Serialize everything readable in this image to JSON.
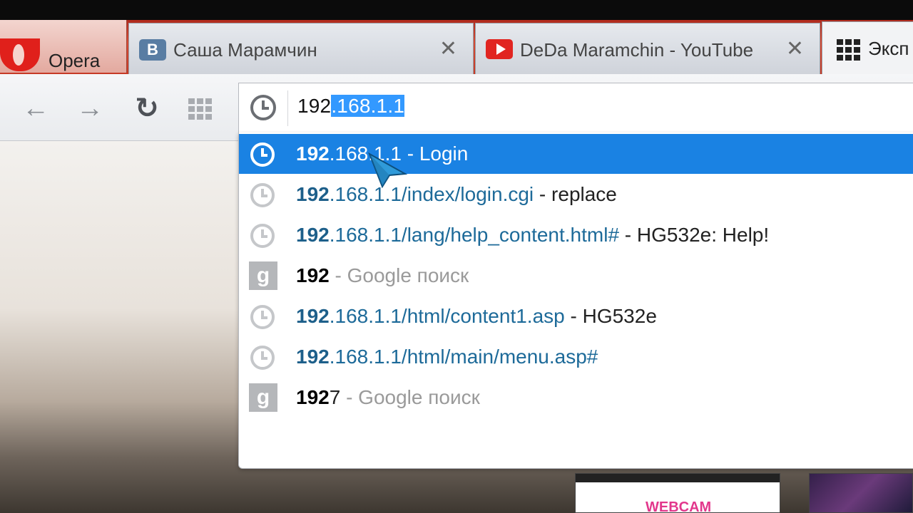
{
  "browser": {
    "menu_label": "Opera"
  },
  "tabs": [
    {
      "title": "Саша Марамчин",
      "favicon": "vk-icon",
      "close": "✕"
    },
    {
      "title": "DeDa Maramchin - YouTube",
      "favicon": "youtube-icon",
      "close": "✕"
    },
    {
      "title": "Эксп",
      "favicon": "speed-dial-icon"
    }
  ],
  "toolbar": {
    "back_icon": "←",
    "forward_icon": "→",
    "reload_icon": "↻"
  },
  "address": {
    "typed": "192",
    "autocompleted": ".168.1.1"
  },
  "suggestions": [
    {
      "icon": "history-clock-icon",
      "match": "192",
      "rest": ".168.1.1",
      "sep": " - ",
      "title": "Login",
      "selected": true
    },
    {
      "icon": "history-clock-icon",
      "match": "192",
      "rest": ".168.1.1/index/login.cgi",
      "sep": " - ",
      "title": "replace"
    },
    {
      "icon": "history-clock-icon",
      "match": "192",
      "rest": ".168.1.1/lang/help_content.html#",
      "sep": " - ",
      "title": "HG532e: Help!"
    },
    {
      "icon": "google-search-icon",
      "query": "192",
      "search": " - Google поиск"
    },
    {
      "icon": "history-clock-icon",
      "match": "192",
      "rest": ".168.1.1/html/content1.asp",
      "sep": " - ",
      "title": "HG532e"
    },
    {
      "icon": "history-clock-icon",
      "match": "192",
      "rest": ".168.1.1/html/main/menu.asp#",
      "sep": "",
      "title": ""
    },
    {
      "icon": "google-search-icon",
      "query": "192",
      "query_rest": "7",
      "search": " - Google поиск"
    }
  ],
  "google_glyph": "g",
  "background": {
    "thumb_label": "WEBCAM"
  },
  "colors": {
    "selection": "#1a82e3",
    "url_text": "#1d6a99",
    "opera_red": "#e0201b"
  }
}
